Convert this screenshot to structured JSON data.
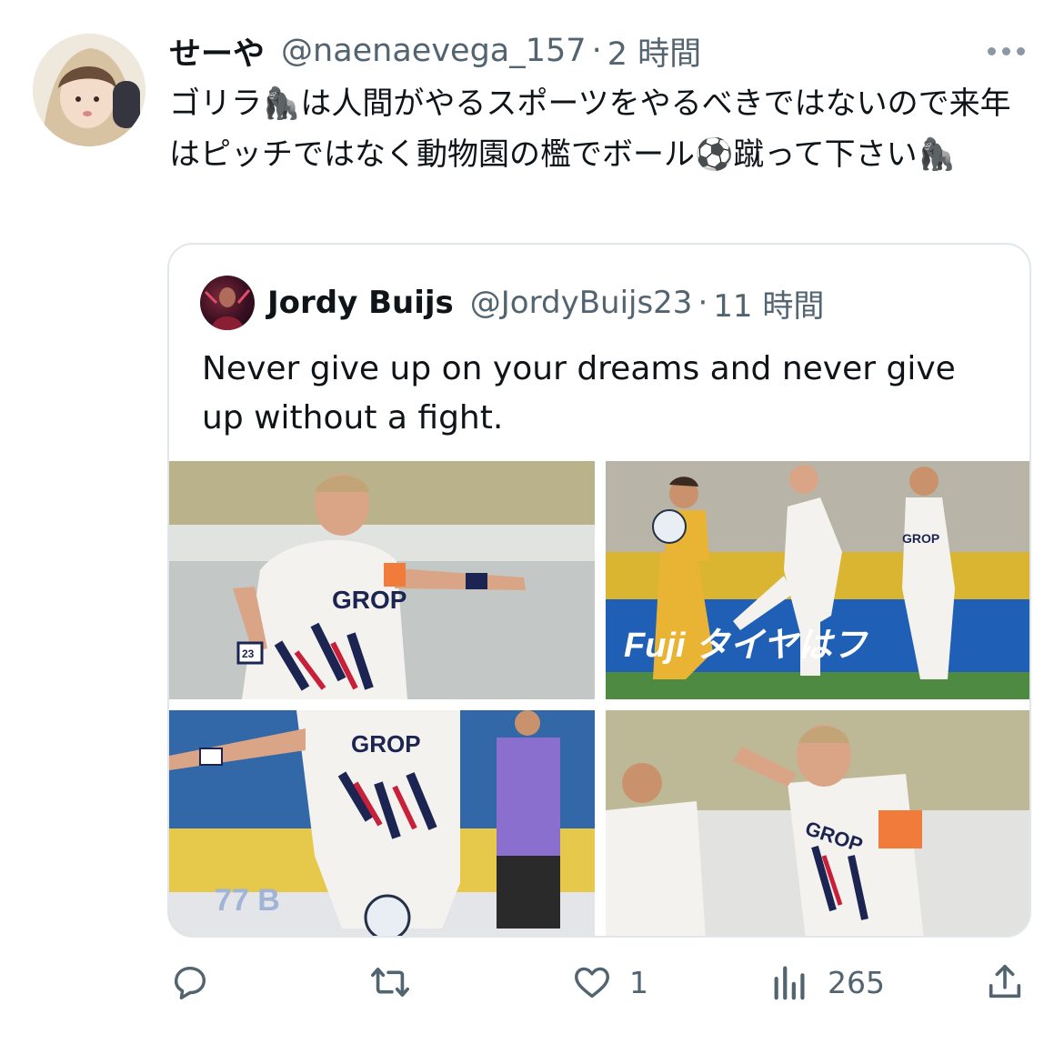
{
  "tweet": {
    "author": {
      "display_name": "せーや",
      "handle": "@naenaevega_157",
      "separator": "·",
      "time": "2 時間"
    },
    "text": "ゴリラ🦍は人間がやるスポーツをやるべきではないので来年はピッチではなく動物園の檻でボール⚽蹴って下さい🦍",
    "more_icon": "more-horizontal-icon"
  },
  "quoted_tweet": {
    "author": {
      "display_name": "Jordy Buijs",
      "handle": "@JordyBuijs23",
      "separator": "·",
      "time": "11 時間"
    },
    "text": "Never give up on your dreams and never give up without a fight.",
    "photos": [
      {
        "jersey_text": "GROP",
        "sleeve_number": "23"
      },
      {
        "jersey_text": "GROP",
        "board_text": "Fuji タイヤはフ"
      },
      {
        "jersey_text": "GROP",
        "board_text": "77 B"
      },
      {
        "jersey_text": "GROP"
      }
    ]
  },
  "actions": {
    "reply": {
      "icon": "reply-icon",
      "count": ""
    },
    "retweet": {
      "icon": "retweet-icon",
      "count": ""
    },
    "like": {
      "icon": "heart-icon",
      "count": "1"
    },
    "views": {
      "icon": "views-icon",
      "count": "265"
    },
    "share": {
      "icon": "share-icon",
      "count": ""
    }
  },
  "colors": {
    "text_primary": "#0f1419",
    "text_secondary": "#536471",
    "border": "#e1e6ea",
    "jersey_red": "#c8203a",
    "jersey_navy": "#1c2452"
  }
}
